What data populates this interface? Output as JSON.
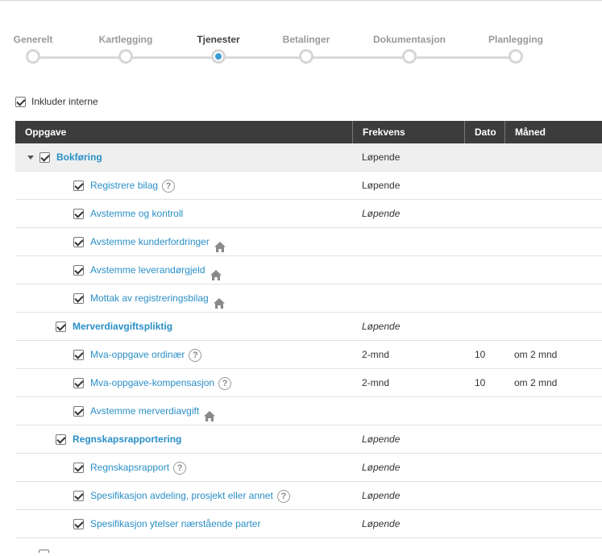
{
  "stepper": {
    "steps": [
      {
        "label": "Generelt",
        "state": "done"
      },
      {
        "label": "Kartlegging",
        "state": "done"
      },
      {
        "label": "Tjenester",
        "state": "active"
      },
      {
        "label": "Betalinger",
        "state": "todo"
      },
      {
        "label": "Dokumentasjon",
        "state": "todo"
      },
      {
        "label": "Planlegging",
        "state": "todo"
      }
    ]
  },
  "filters": {
    "include_internal_label": "Inkluder interne",
    "include_internal_checked": true
  },
  "table": {
    "headers": {
      "task": "Oppgave",
      "frequency": "Frekvens",
      "date": "Dato",
      "month": "Måned"
    },
    "rows": [
      {
        "label": "Bokføring",
        "level": 0,
        "expandable": true,
        "bold": true,
        "checked": true,
        "frequency": "Løpende",
        "frequency_italic": false,
        "date": "",
        "month": "",
        "icon": ""
      },
      {
        "label": "Registrere bilag",
        "level": 2,
        "checked": true,
        "frequency": "Løpende",
        "frequency_italic": false,
        "date": "",
        "month": "",
        "icon": "help-icon"
      },
      {
        "label": "Avstemme og kontroll",
        "level": 2,
        "checked": true,
        "frequency": "Løpende",
        "frequency_italic": true,
        "date": "",
        "month": "",
        "icon": ""
      },
      {
        "label": "Avstemme kunderfordringer",
        "level": 2,
        "checked": true,
        "frequency": "",
        "frequency_italic": false,
        "date": "",
        "month": "",
        "icon": "house-icon"
      },
      {
        "label": "Avstemme leverandørgjeld",
        "level": 2,
        "checked": true,
        "frequency": "",
        "frequency_italic": false,
        "date": "",
        "month": "",
        "icon": "house-icon"
      },
      {
        "label": "Mottak av registreringsbilag",
        "level": 2,
        "checked": true,
        "frequency": "",
        "frequency_italic": false,
        "date": "",
        "month": "",
        "icon": "house-icon"
      },
      {
        "label": "Merverdiavgiftspliktig",
        "level": 1,
        "bold": true,
        "checked": true,
        "frequency": "Løpende",
        "frequency_italic": true,
        "date": "",
        "month": "",
        "icon": ""
      },
      {
        "label": "Mva-oppgave ordinær",
        "level": 2,
        "checked": true,
        "frequency": "2-mnd",
        "frequency_italic": false,
        "date": "10",
        "month": "om 2 mnd",
        "icon": "help-icon"
      },
      {
        "label": "Mva-oppgave-kompensasjon",
        "level": 2,
        "checked": true,
        "frequency": "2-mnd",
        "frequency_italic": false,
        "date": "10",
        "month": "om 2 mnd",
        "icon": "help-icon"
      },
      {
        "label": "Avstemme merverdiavgift",
        "level": 2,
        "checked": true,
        "frequency": "",
        "frequency_italic": false,
        "date": "",
        "month": "",
        "icon": "house-icon"
      },
      {
        "label": "Regnskapsrapportering",
        "level": 1,
        "bold": true,
        "checked": true,
        "frequency": "Løpende",
        "frequency_italic": true,
        "date": "",
        "month": "",
        "icon": ""
      },
      {
        "label": "Regnskapsrapport",
        "level": 2,
        "checked": true,
        "frequency": "Løpende",
        "frequency_italic": true,
        "date": "",
        "month": "",
        "icon": "help-icon"
      },
      {
        "label": "Spesifikasjon avdeling, prosjekt eller annet",
        "level": 2,
        "checked": true,
        "frequency": "Løpende",
        "frequency_italic": true,
        "date": "",
        "month": "",
        "icon": "help-icon"
      },
      {
        "label": "Spesifikasjon ytelser nærstående parter",
        "level": 2,
        "checked": true,
        "frequency": "Løpende",
        "frequency_italic": true,
        "date": "",
        "month": "",
        "icon": ""
      }
    ]
  },
  "colors": {
    "link": "#2a8fc7",
    "active_step": "#3a9bd5",
    "header_bg": "#3c3c3c"
  }
}
